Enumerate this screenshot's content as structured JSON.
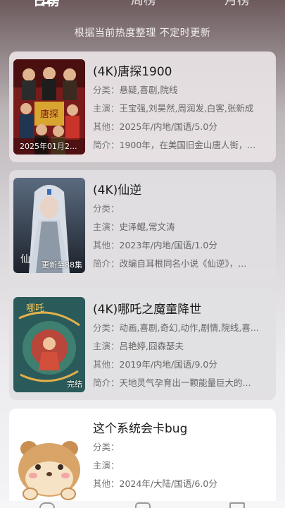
{
  "tabs": [
    {
      "label": "日榜",
      "active": true
    },
    {
      "label": "周榜",
      "active": false
    },
    {
      "label": "月榜",
      "active": false
    }
  ],
  "subtitle": "根据当前热度整理 不定时更新",
  "labels": {
    "category": "分类：",
    "cast": "主演：",
    "other": "其他：",
    "summary": "简介："
  },
  "items": [
    {
      "title": "(4K)唐探1900",
      "badge": "2025年01月2...",
      "category": "悬疑,喜剧,院线",
      "cast": "王宝强,刘昊然,周润发,白客,张新成",
      "other": "2025年/内地/国语/5.0分",
      "summary": "1900年，在美国旧金山唐人街，...",
      "poster_colors": [
        "#7a1b1b",
        "#c8342a",
        "#2a1a14"
      ]
    },
    {
      "title": "(4K)仙逆",
      "badge": "更新至88集",
      "category": "",
      "cast": "史泽鲲,常文涛",
      "other": "2023年/内地/国语/1.0分",
      "summary": "改编自耳根同名小说《仙逆》，...",
      "poster_colors": [
        "#3b4656",
        "#a9b3c2",
        "#1d222b"
      ]
    },
    {
      "title": "(4K)哪吒之魔童降世",
      "badge": "完结",
      "category": "动画,喜剧,奇幻,动作,剧情,院线,喜...",
      "cast": "吕艳婷,囧森瑟夫",
      "other": "2019年/内地/国语/9.0分",
      "summary": "天地灵气孕育出一颗能量巨大的...",
      "poster_colors": [
        "#2a5b5a",
        "#b8463a",
        "#1a2a30"
      ]
    },
    {
      "title": "这个系统会卡bug",
      "badge": "",
      "category": "",
      "cast": "",
      "other": "2024年/大陆/国语/6.0分",
      "summary": "",
      "poster_colors": [
        "#f2d6a8",
        "#c98e52",
        "#ffffff"
      ]
    }
  ]
}
